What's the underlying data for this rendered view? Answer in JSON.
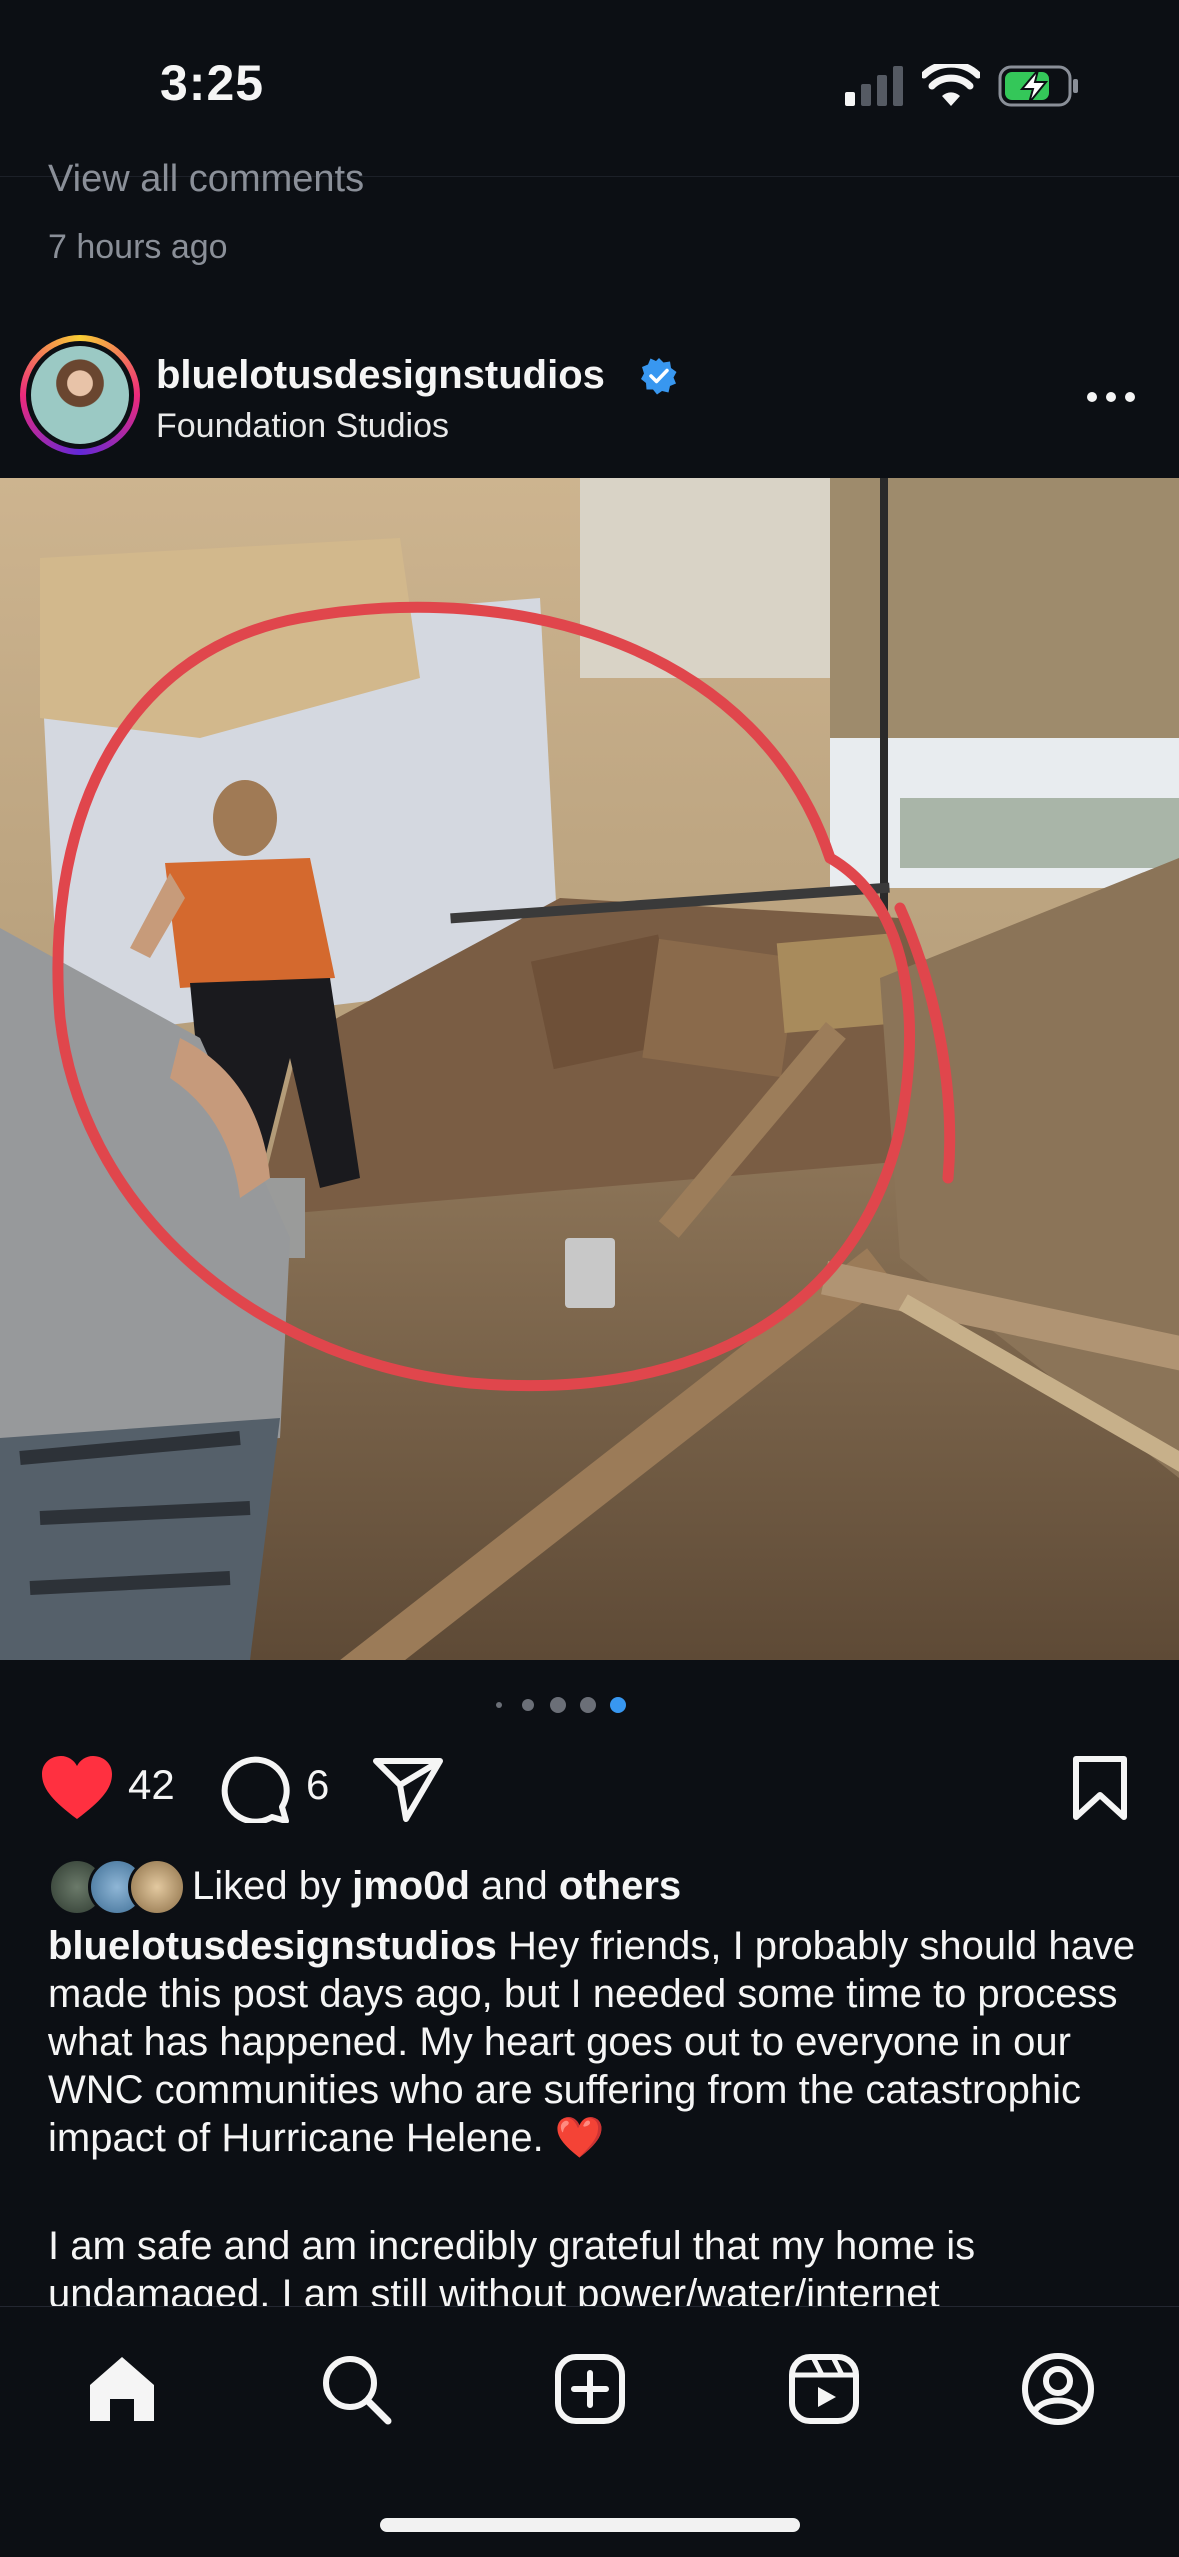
{
  "status_bar": {
    "time": "3:25"
  },
  "previous_post": {
    "view_comments": "View all comments",
    "timestamp": "7 hours ago"
  },
  "post": {
    "username": "bluelotusdesignstudios",
    "location": "Foundation Studios",
    "carousel": {
      "total": 5,
      "active_index": 4
    },
    "likes": "42",
    "comments": "6",
    "liked_by": {
      "prefix": "Liked by",
      "user": "jmo0d",
      "middle": "and",
      "others": "others"
    },
    "caption": {
      "author": "bluelotusdesignstudios",
      "text": "Hey friends, I probably should have made this post days ago, but I needed some time to process what has happened. My heart goes out to everyone in our WNC communities who are suffering from the catastrophic impact of Hurricane Helene. ❤️",
      "paragraph2": "I am safe and am incredibly grateful that my home is undamaged. I am still without power/water/internet"
    }
  },
  "icons": {
    "like": "heart-filled-icon",
    "comment": "comment-bubble-icon",
    "share": "paper-plane-icon",
    "save": "bookmark-icon",
    "more": "more-dots-icon"
  },
  "tab_bar": [
    "home",
    "search",
    "create",
    "reels",
    "profile"
  ],
  "colors": {
    "background": "#0c0f14",
    "like_red": "#ff3040",
    "verified_blue": "#3897f0",
    "annotation_red": "#e0464c"
  }
}
